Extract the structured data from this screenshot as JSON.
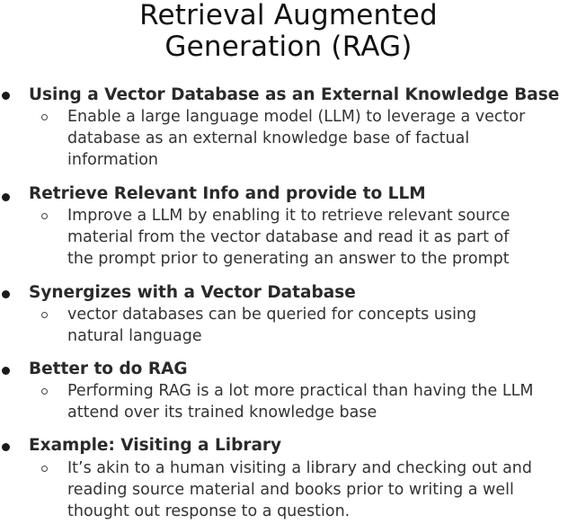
{
  "title": {
    "line1": "Retrieval Augmented",
    "line2": "Generation (RAG)"
  },
  "items": [
    {
      "heading": "Using a Vector Database as an External Knowledge Base",
      "body": [
        "Enable a large language model (LLM) to leverage a vector",
        "database as an external knowledge base of factual",
        "information"
      ]
    },
    {
      "heading": "Retrieve Relevant Info and provide to LLM",
      "body": [
        "Improve a LLM by enabling it to retrieve relevant source",
        "material from the vector database and read it as part of",
        "the prompt prior to generating an answer to the prompt"
      ]
    },
    {
      "heading": "Synergizes with a Vector Database",
      "body": [
        "vector databases can be queried for concepts using",
        "natural language"
      ]
    },
    {
      "heading": "Better to do RAG",
      "body": [
        "Performing RAG is a lot more practical than having the LLM",
        "attend over its trained knowledge base"
      ]
    },
    {
      "heading": "Example: Visiting a Library",
      "body": [
        "It’s akin to a human visiting a library and checking out and",
        "reading source material and books prior to writing a well",
        "thought out response to a question."
      ]
    }
  ]
}
